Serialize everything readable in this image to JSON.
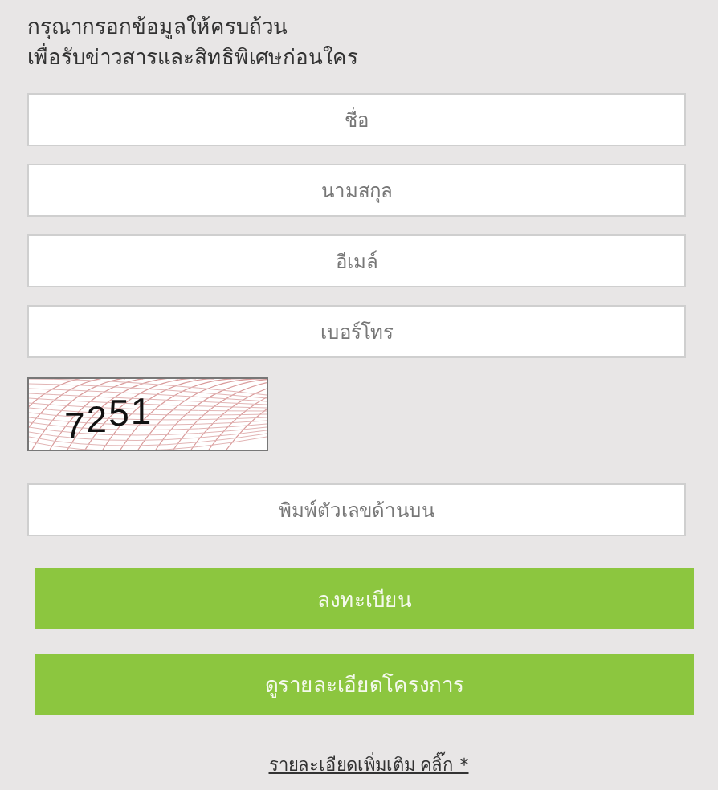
{
  "heading": [
    "กรุณากรอกข้อมูลให้ครบถ้วน",
    "เพื่อรับข่าวสารและสิทธิพิเศษก่อนใคร"
  ],
  "fields": [
    {
      "placeholder": "ชื่อ"
    },
    {
      "placeholder": "นามสกุล"
    },
    {
      "placeholder": "อีเมล์"
    },
    {
      "placeholder": "เบอร์โทร"
    }
  ],
  "captcha": {
    "code": [
      "7",
      "2",
      "5",
      "1"
    ]
  },
  "captcha_field": {
    "placeholder": "พิมพ์ตัวเลขด้านบน"
  },
  "buttons": [
    "ลงทะเบียน",
    "ดูรายละเอียดโครงการ"
  ],
  "more_link": "รายละเอียดเพิ่มเติม คลิ๊ก *"
}
